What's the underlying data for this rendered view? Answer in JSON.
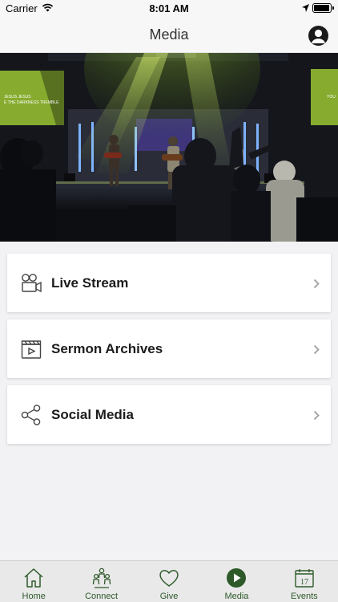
{
  "status_bar": {
    "carrier": "Carrier",
    "time": "8:01 AM"
  },
  "header": {
    "title": "Media"
  },
  "hero": {
    "screen_left_line1": "JESUS JESUS",
    "screen_left_line2": "E THE DARKNESS TREMBLE",
    "screen_right_text": "YOU"
  },
  "menu": [
    {
      "label": "Live Stream",
      "icon": "video-camera-icon"
    },
    {
      "label": "Sermon Archives",
      "icon": "clapperboard-icon"
    },
    {
      "label": "Social Media",
      "icon": "share-icon"
    }
  ],
  "tabs": [
    {
      "label": "Home",
      "icon": "home-icon"
    },
    {
      "label": "Connect",
      "icon": "people-icon"
    },
    {
      "label": "Give",
      "icon": "heart-icon"
    },
    {
      "label": "Media",
      "icon": "play-circle-icon",
      "active": true
    },
    {
      "label": "Events",
      "icon": "calendar-icon",
      "day": "17"
    }
  ],
  "colors": {
    "brand_green": "#2e5a2a",
    "stage_light_green": "#b8e23a",
    "card_bg": "#ffffff",
    "page_bg": "#f2f2f4"
  }
}
